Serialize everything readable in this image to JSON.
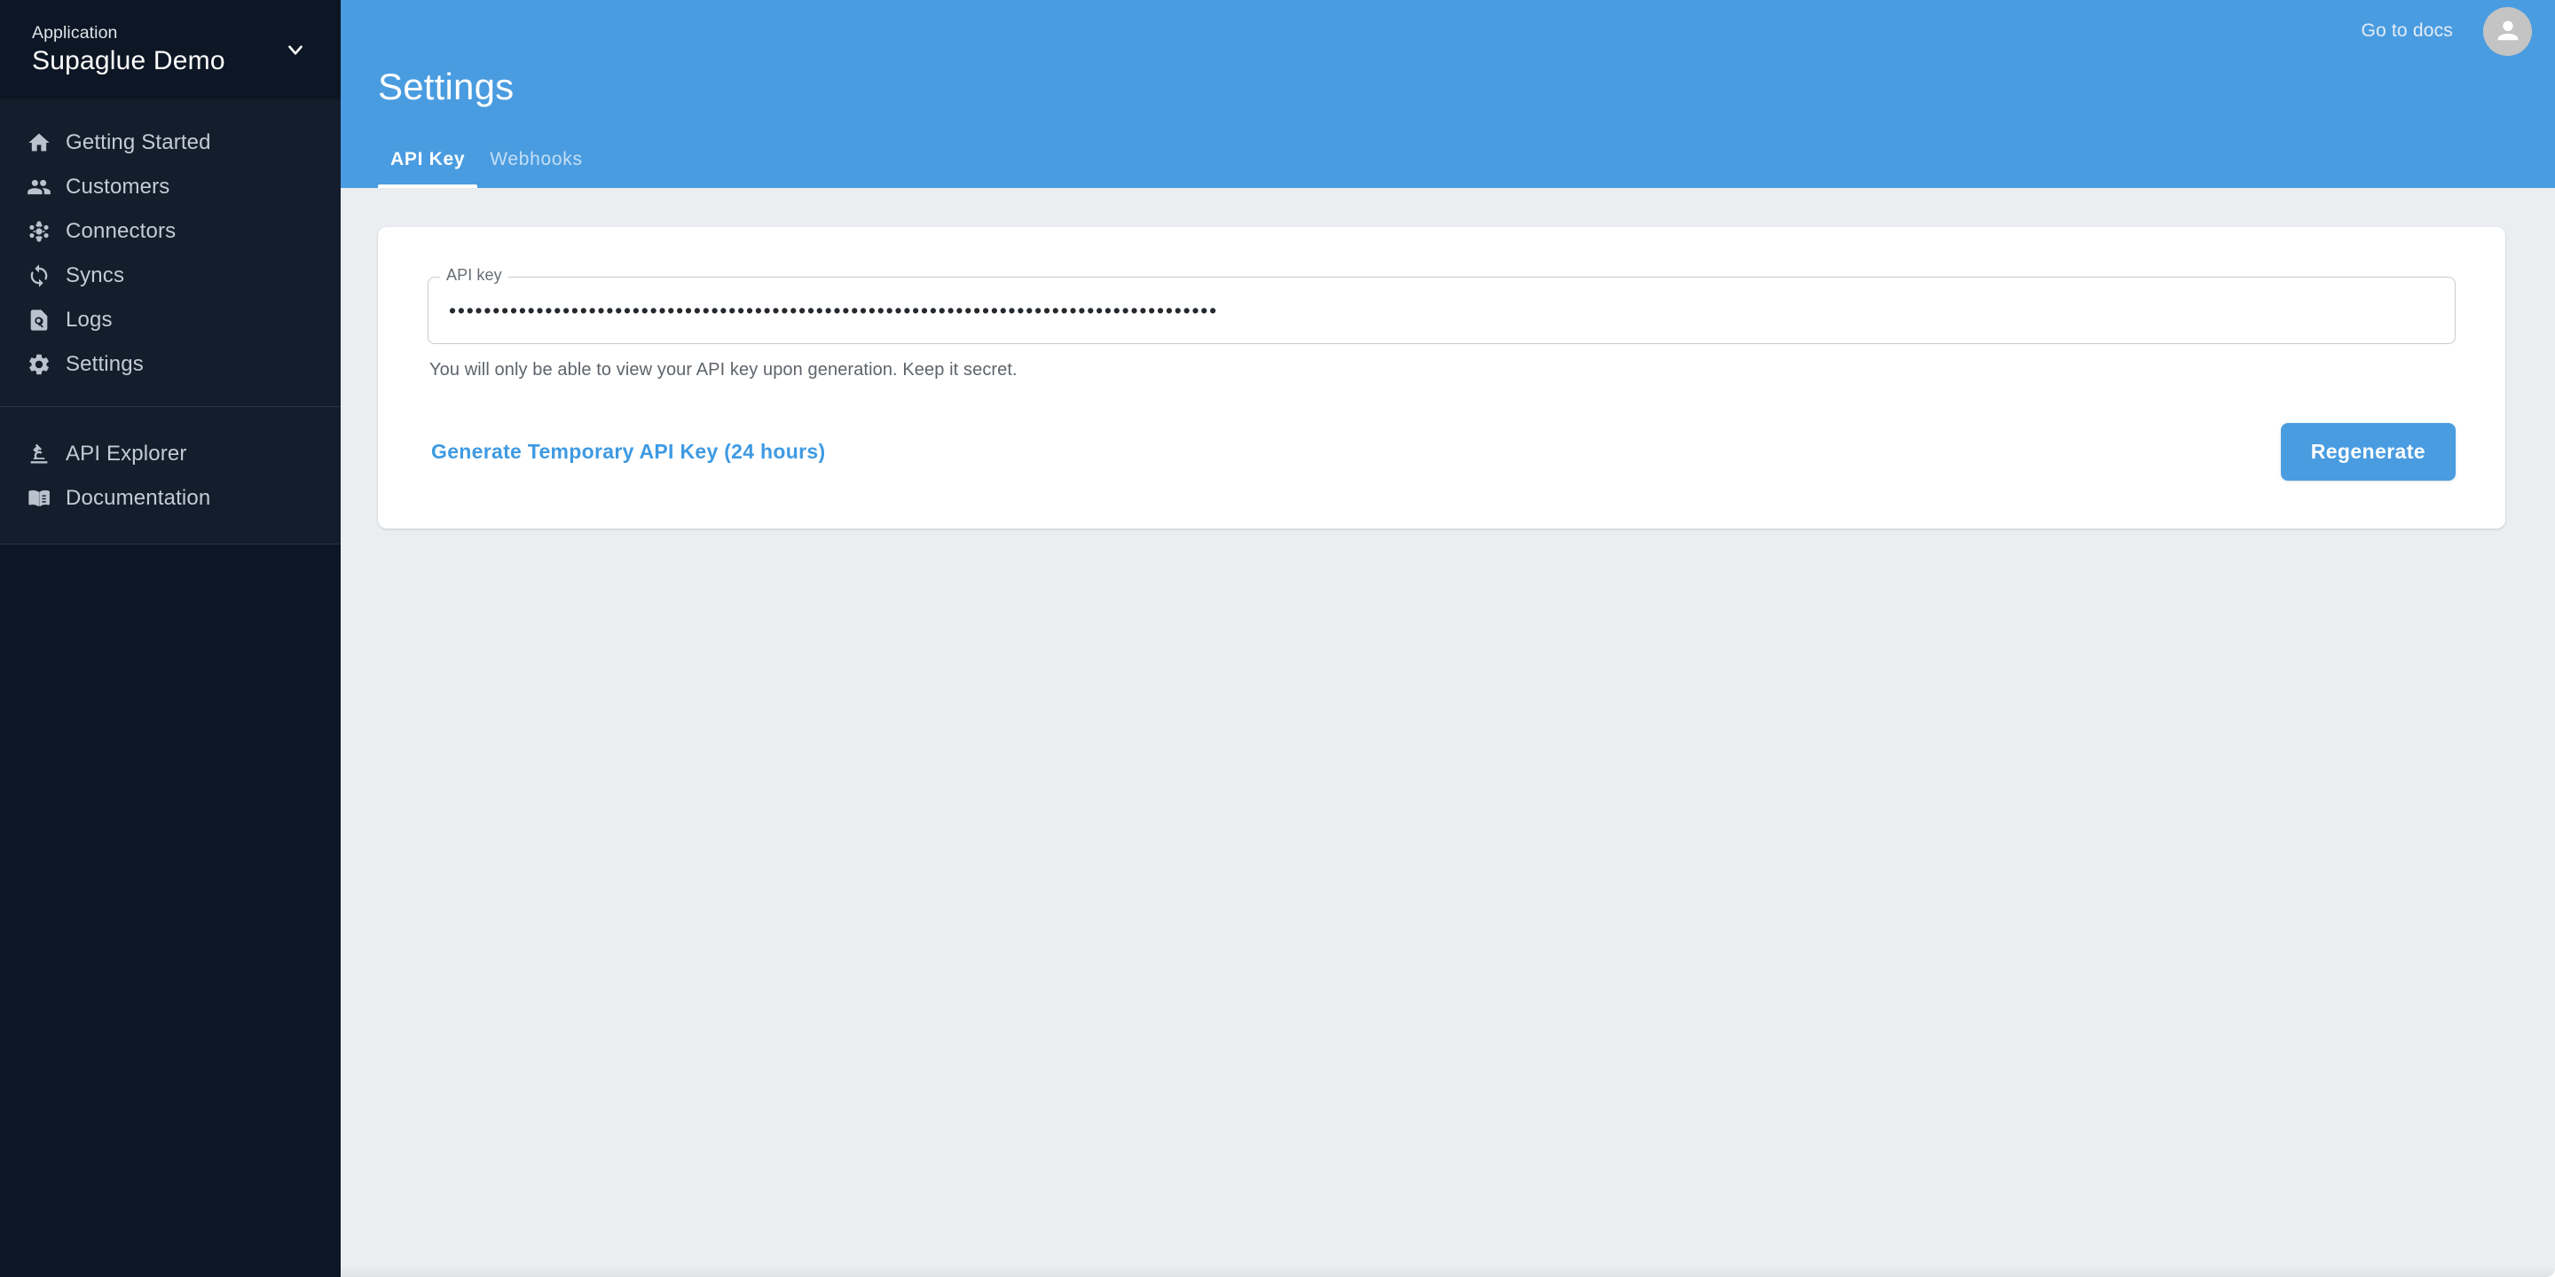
{
  "sidebar": {
    "app_label": "Application",
    "app_name": "Supaglue Demo",
    "chevron_icon": "chevron-down-icon",
    "primary_items": [
      {
        "label": "Getting Started",
        "icon": "home-icon"
      },
      {
        "label": "Customers",
        "icon": "people-icon"
      },
      {
        "label": "Connectors",
        "icon": "hub-icon"
      },
      {
        "label": "Syncs",
        "icon": "sync-icon"
      },
      {
        "label": "Logs",
        "icon": "document-search-icon"
      },
      {
        "label": "Settings",
        "icon": "gear-icon"
      }
    ],
    "secondary_items": [
      {
        "label": "API Explorer",
        "icon": "microscope-icon"
      },
      {
        "label": "Documentation",
        "icon": "open-book-icon"
      }
    ]
  },
  "header": {
    "title": "Settings",
    "docs_link": "Go to docs",
    "avatar_icon": "person-avatar-icon",
    "accent_color": "#4a9ce0",
    "tabs": [
      {
        "label": "API Key",
        "active": true
      },
      {
        "label": "Webhooks",
        "active": false
      }
    ]
  },
  "main": {
    "api_key_field": {
      "label": "API key",
      "value": "••••••••••••••••••••••••••••••••••••••••••••••••••••••••••••••••••••••••••••••••••••••••",
      "placeholder": ""
    },
    "helper_text": "You will only be able to view your API key upon generation. Keep it secret.",
    "generate_temp_label": "Generate Temporary API Key (24 hours)",
    "regenerate_label": "Regenerate"
  }
}
